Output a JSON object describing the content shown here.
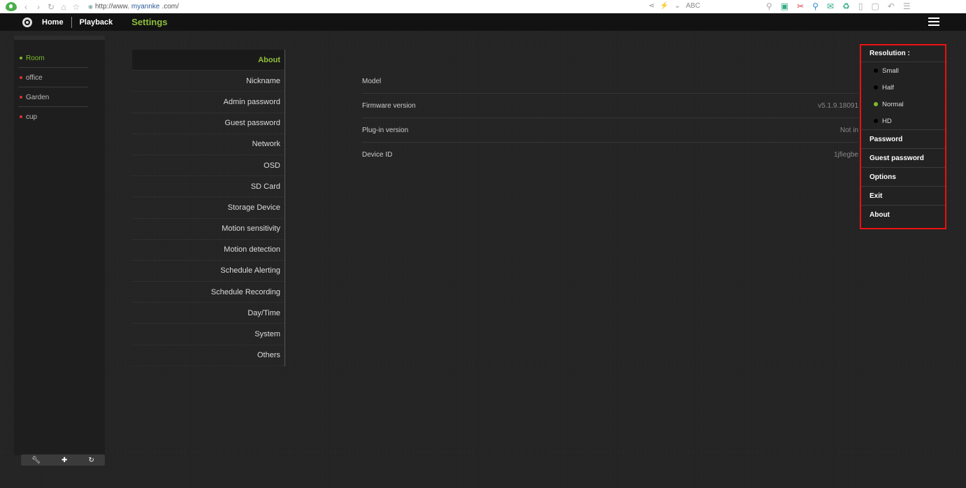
{
  "browser": {
    "url_prefix": "http://www.",
    "url_domain": "myannke",
    "url_suffix": ".com/",
    "center_tool_text": "ABC",
    "nav_icons": [
      "back-icon",
      "forward-icon",
      "refresh-icon",
      "home-icon",
      "star-icon"
    ]
  },
  "header": {
    "home_tab": "Home",
    "playback_tab": "Playback",
    "settings_tab": "Settings",
    "accent_color": "#8fbf3a"
  },
  "devices": [
    {
      "label": "Room",
      "active": true
    },
    {
      "label": "office",
      "active": false
    },
    {
      "label": "Garden",
      "active": false
    },
    {
      "label": "cup",
      "active": false
    }
  ],
  "settings_menu": [
    {
      "label": "About",
      "active": true
    },
    {
      "label": "Nickname"
    },
    {
      "label": "Admin password"
    },
    {
      "label": "Guest password"
    },
    {
      "label": "Network"
    },
    {
      "label": "OSD"
    },
    {
      "label": "SD Card"
    },
    {
      "label": "Storage Device"
    },
    {
      "label": "Motion sensitivity"
    },
    {
      "label": "Motion detection"
    },
    {
      "label": "Schedule Alerting"
    },
    {
      "label": "Schedule Recording"
    },
    {
      "label": "Day/Time"
    },
    {
      "label": "System"
    },
    {
      "label": "Others"
    }
  ],
  "about_info": [
    {
      "label": "Model",
      "value": ""
    },
    {
      "label": "Firmware version",
      "value": "v5.1.9.18091"
    },
    {
      "label": "Plug-in version",
      "value": "Not in"
    },
    {
      "label": "Device ID",
      "value": "1jfiegbe"
    }
  ],
  "dropdown": {
    "resolution_label": "Resolution :",
    "resolution_options": [
      {
        "label": "Small",
        "selected": false
      },
      {
        "label": "Half",
        "selected": false
      },
      {
        "label": "Normal",
        "selected": true
      },
      {
        "label": "HD",
        "selected": false
      }
    ],
    "items": [
      "Password",
      "Guest password",
      "Options",
      "Exit",
      "About"
    ],
    "highlight_color": "#ee1111"
  },
  "device_footer_icons": [
    "wrench-icon",
    "plus-icon",
    "refresh-icon"
  ]
}
